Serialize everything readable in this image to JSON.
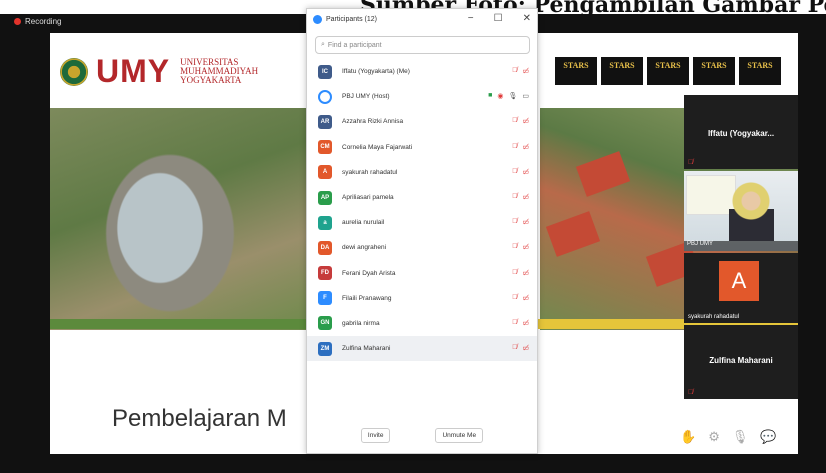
{
  "caption": "Sumber Foto: Pengambilan Gambar Pembelajaran Menggunakan Zoom... ",
  "recording": "Recording",
  "slide": {
    "logo_text": "UMY",
    "university_lines": [
      "UNIVERSITAS",
      "MUHAMMADIYAH",
      "YOGYAKARTA"
    ],
    "title": "Pembelajaran M",
    "star_badges": [
      "STARS",
      "STARS",
      "STARS",
      "STARS",
      "STARS"
    ]
  },
  "panel": {
    "title": "Participants (12)",
    "window_buttons": [
      "−",
      "☐",
      "✕"
    ],
    "search_placeholder": "Find a participant",
    "participants": [
      {
        "initials": "IC",
        "name": "Iffatu (Yogyakarta) (Me)",
        "color": "#3f5b8a"
      },
      {
        "initials": "",
        "name": "PBJ UMY (Host)",
        "color": "#2d8cff"
      },
      {
        "initials": "AR",
        "name": "Azzahra Rizki Annisa",
        "color": "#3f5b8a"
      },
      {
        "initials": "CM",
        "name": "Cornelia Maya Fajarwati",
        "color": "#e2582b"
      },
      {
        "initials": "A",
        "name": "syakurah rahadatul",
        "color": "#e2582b"
      },
      {
        "initials": "AP",
        "name": "Apriliasari pamela",
        "color": "#2a9d4b"
      },
      {
        "initials": "a",
        "name": "aurelia nurulail",
        "color": "#1fa38e"
      },
      {
        "initials": "DA",
        "name": "dewi angraheni",
        "color": "#e2582b"
      },
      {
        "initials": "FD",
        "name": "Ferani Dyah Arista",
        "color": "#c63b3b"
      },
      {
        "initials": "F",
        "name": "Filaili Pranawang",
        "color": "#2d8cff"
      },
      {
        "initials": "GN",
        "name": "gabrila nirma",
        "color": "#2a9d4b"
      },
      {
        "initials": "ZM",
        "name": "Zulfina Maharani",
        "color": "#2d6fc0"
      }
    ],
    "invite_label": "Invite",
    "unmute_label": "Unmute Me"
  },
  "tiles": {
    "tile1_name": "Iffatu (Yogyakar...",
    "tile2_label": "PBJ UMY",
    "tile3_letter": "A",
    "tile3_name": "syakurah rahadatul",
    "tile4_name": "Zulfina Maharani"
  }
}
